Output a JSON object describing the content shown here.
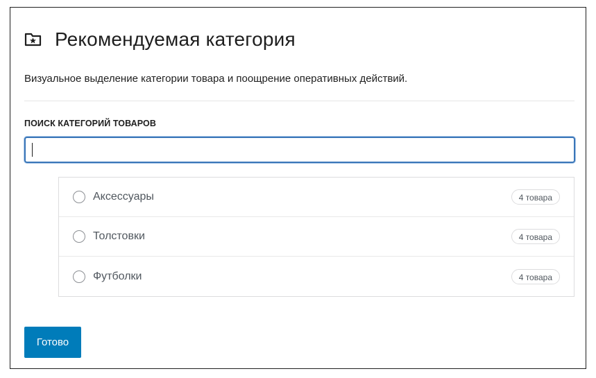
{
  "header": {
    "icon": "folder-star-icon",
    "title": "Рекомендуемая категория"
  },
  "description": "Визуальное выделение категории товара и поощрение оперативных действий.",
  "search": {
    "label": "ПОИСК КАТЕГОРИЙ ТОВАРОВ",
    "value": "",
    "placeholder": ""
  },
  "categories": [
    {
      "label": "Аксессуары",
      "count": "4 товара"
    },
    {
      "label": "Толстовки",
      "count": "4 товара"
    },
    {
      "label": "Футболки",
      "count": "4 товара"
    }
  ],
  "footer": {
    "done_label": "Готово"
  },
  "colors": {
    "accent": "#007cba",
    "focus_border": "#3a76b8",
    "text": "#1e1e1e",
    "muted_text": "#50575e"
  }
}
